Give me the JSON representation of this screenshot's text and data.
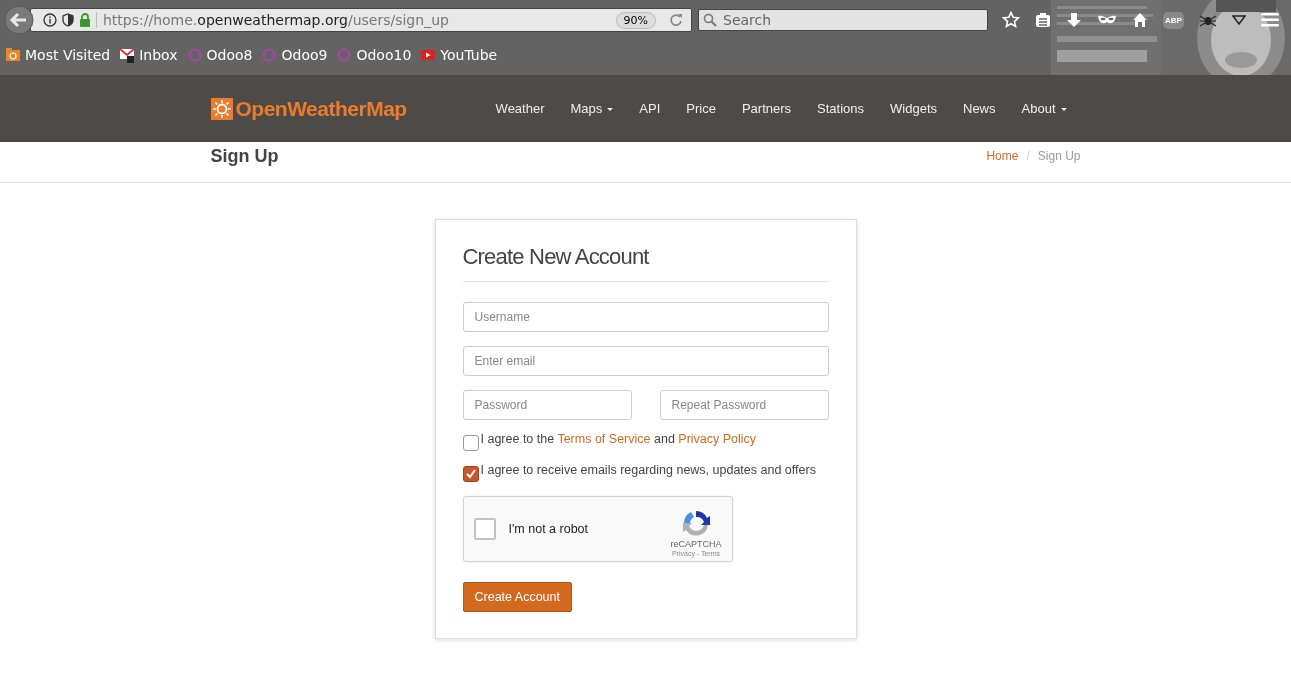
{
  "browser": {
    "url": {
      "prefix": "https://home.",
      "domain": "openweathermap.org",
      "path": "/users/sign_up"
    },
    "zoom": "90%",
    "search": {
      "placeholder": "Search"
    },
    "toolbar_badge": "ABP",
    "bookmarks": [
      {
        "label": "Most Visited",
        "kind": "folder"
      },
      {
        "label": "Inbox",
        "kind": "mail"
      },
      {
        "label": "Odoo8",
        "kind": "ring"
      },
      {
        "label": "Odoo9",
        "kind": "ring"
      },
      {
        "label": "Odoo10",
        "kind": "ring"
      },
      {
        "label": "YouTube",
        "kind": "video"
      }
    ]
  },
  "site": {
    "logo": "OpenWeatherMap",
    "nav": [
      {
        "label": "Weather",
        "dropdown": false
      },
      {
        "label": "Maps",
        "dropdown": true
      },
      {
        "label": "API",
        "dropdown": false
      },
      {
        "label": "Price",
        "dropdown": false
      },
      {
        "label": "Partners",
        "dropdown": false
      },
      {
        "label": "Stations",
        "dropdown": false
      },
      {
        "label": "Widgets",
        "dropdown": false
      },
      {
        "label": "News",
        "dropdown": false
      },
      {
        "label": "About",
        "dropdown": true
      }
    ]
  },
  "page_title": "Sign Up",
  "breadcrumb": {
    "separator": "/",
    "items": [
      {
        "label": "Home",
        "link": true
      },
      {
        "label": "Sign Up",
        "link": false
      }
    ]
  },
  "form": {
    "title": "Create New Account",
    "fields": [
      {
        "placeholder": "Username"
      },
      {
        "placeholder": "Enter email"
      }
    ],
    "password_fields": [
      {
        "placeholder": "Password"
      },
      {
        "placeholder": "Repeat Password"
      }
    ],
    "checkboxes": [
      {
        "checked": false,
        "parts": [
          {
            "text": "I agree to the ",
            "link": false
          },
          {
            "text": "Terms of Service",
            "link": true
          },
          {
            "text": " and ",
            "link": false
          },
          {
            "text": "Privacy Policy",
            "link": true
          }
        ]
      },
      {
        "checked": true,
        "parts": [
          {
            "text": "I agree to receive emails regarding news, updates and offers",
            "link": false
          }
        ]
      }
    ],
    "captcha": {
      "label": "I'm not a robot",
      "checked": false,
      "brand": "reCAPTCHA",
      "links": "Privacy - Terms"
    },
    "submit": "Create Account"
  }
}
